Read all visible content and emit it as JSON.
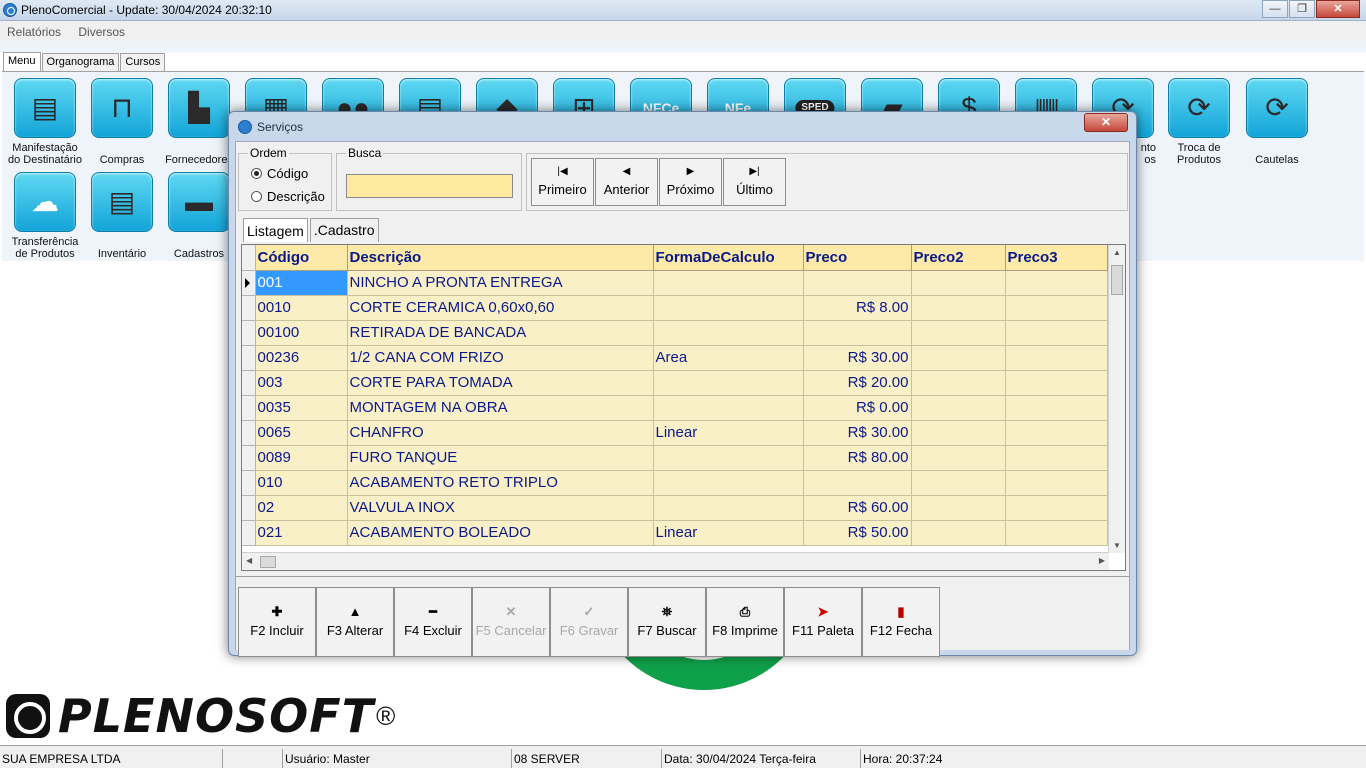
{
  "window": {
    "title": "PlenoComercial - Update: 30/04/2024 20:32:10",
    "min": "—",
    "max": "❐",
    "close": "✕"
  },
  "menu": {
    "items": [
      "Relatórios",
      "Diversos"
    ]
  },
  "main_tabs": [
    "Menu",
    "Organograma",
    "Cursos"
  ],
  "toolbar": {
    "row1": [
      {
        "label": "Manifestação do Destinatário",
        "icon": "document-check-icon"
      },
      {
        "label": "Compras",
        "icon": "shopping-bag-icon"
      },
      {
        "label": "Fornecedores",
        "icon": "factory-icon"
      },
      {
        "label": "",
        "icon": "boxes-icon"
      },
      {
        "label": "",
        "icon": "users-icon"
      },
      {
        "label": "",
        "icon": "document-search-icon"
      },
      {
        "label": "",
        "icon": "handshake-icon"
      },
      {
        "label": "",
        "icon": "cart-icon"
      },
      {
        "label": "",
        "icon": "nfce-icon"
      },
      {
        "label": "",
        "icon": "nfe-icon"
      },
      {
        "label": "",
        "icon": "sped-icon"
      },
      {
        "label": "",
        "icon": "truck-icon"
      },
      {
        "label": "",
        "icon": "money-icon"
      },
      {
        "label": "",
        "icon": "barcode-icon"
      },
      {
        "label": "nto\nos",
        "icon": "refresh-icon"
      },
      {
        "label": "Troca de Produtos",
        "icon": "exchange-icon"
      },
      {
        "label": "Cautelas",
        "icon": "exchange-icon"
      }
    ],
    "row2": [
      {
        "label": "Transferência de Produtos",
        "icon": "cloud-upload-icon"
      },
      {
        "label": "Inventário",
        "icon": "clipboard-check-icon"
      },
      {
        "label": "Cadastros",
        "icon": "folder-icon"
      }
    ]
  },
  "dialog": {
    "title": "Serviços",
    "close": "✕",
    "ordem": {
      "legend": "Ordem",
      "options": [
        "Código",
        "Descrição"
      ],
      "selected": 0
    },
    "busca": {
      "legend": "Busca",
      "value": ""
    },
    "nav": [
      {
        "label": "Primeiro",
        "glyph": "|◀"
      },
      {
        "label": "Anterior",
        "glyph": "◀"
      },
      {
        "label": "Próximo",
        "glyph": "▶"
      },
      {
        "label": "Último",
        "glyph": "▶|"
      }
    ],
    "tabs": [
      "Listagem",
      ".Cadastro"
    ],
    "grid": {
      "columns": [
        "Código",
        "Descrição",
        "FormaDeCalculo",
        "Preco",
        "Preco2",
        "Preco3"
      ],
      "rows": [
        [
          "001",
          "NINCHO A PRONTA ENTREGA",
          "",
          "",
          "",
          ""
        ],
        [
          "0010",
          "CORTE CERAMICA 0,60x0,60",
          "",
          "R$ 8.00",
          "",
          ""
        ],
        [
          "00100",
          "RETIRADA DE BANCADA",
          "",
          "",
          "",
          ""
        ],
        [
          "00236",
          "1/2 CANA COM FRIZO",
          "Area",
          "R$ 30.00",
          "",
          ""
        ],
        [
          "003",
          "CORTE PARA TOMADA",
          "",
          "R$ 20.00",
          "",
          ""
        ],
        [
          "0035",
          "MONTAGEM NA OBRA",
          "",
          "R$ 0.00",
          "",
          ""
        ],
        [
          "0065",
          "CHANFRO",
          "Linear",
          "R$ 30.00",
          "",
          ""
        ],
        [
          "0089",
          "FURO TANQUE",
          "",
          "R$ 80.00",
          "",
          ""
        ],
        [
          "010",
          "ACABAMENTO RETO TRIPLO",
          "",
          "",
          "",
          ""
        ],
        [
          "02",
          "VALVULA INOX",
          "",
          "R$ 60.00",
          "",
          ""
        ],
        [
          "021",
          "ACABAMENTO BOLEADO",
          "Linear",
          "R$ 50.00",
          "",
          ""
        ]
      ],
      "selected_row": 0
    },
    "actions": [
      {
        "label": "F2 Incluir",
        "glyph": "✚",
        "enabled": true,
        "icon": "plus-icon"
      },
      {
        "label": "F3 Alterar",
        "glyph": "▲",
        "enabled": true,
        "icon": "triangle-up-icon"
      },
      {
        "label": "F4 Excluir",
        "glyph": "━",
        "enabled": true,
        "icon": "minus-icon"
      },
      {
        "label": "F5 Cancelar",
        "glyph": "✕",
        "enabled": false,
        "icon": "cancel-icon"
      },
      {
        "label": "F6 Gravar",
        "glyph": "✓",
        "enabled": false,
        "icon": "check-icon"
      },
      {
        "label": "F7 Buscar",
        "glyph": "⛯",
        "enabled": true,
        "icon": "binoculars-icon"
      },
      {
        "label": "F8 Imprime",
        "glyph": "⎙",
        "enabled": true,
        "icon": "printer-icon"
      },
      {
        "label": "F11 Paleta",
        "glyph": "➤",
        "enabled": true,
        "icon": "palette-icon"
      },
      {
        "label": "F12 Fecha",
        "glyph": "▮",
        "enabled": true,
        "icon": "door-icon"
      }
    ]
  },
  "logo": {
    "text": "PLENOSOFT",
    "reg": "®"
  },
  "status": {
    "company": "SUA EMPRESA LTDA",
    "blank": "",
    "user": "Usuário: Master",
    "server": "08 SERVER",
    "date": "Data: 30/04/2024 Terça-feira",
    "time": "Hora: 20:37:24"
  }
}
